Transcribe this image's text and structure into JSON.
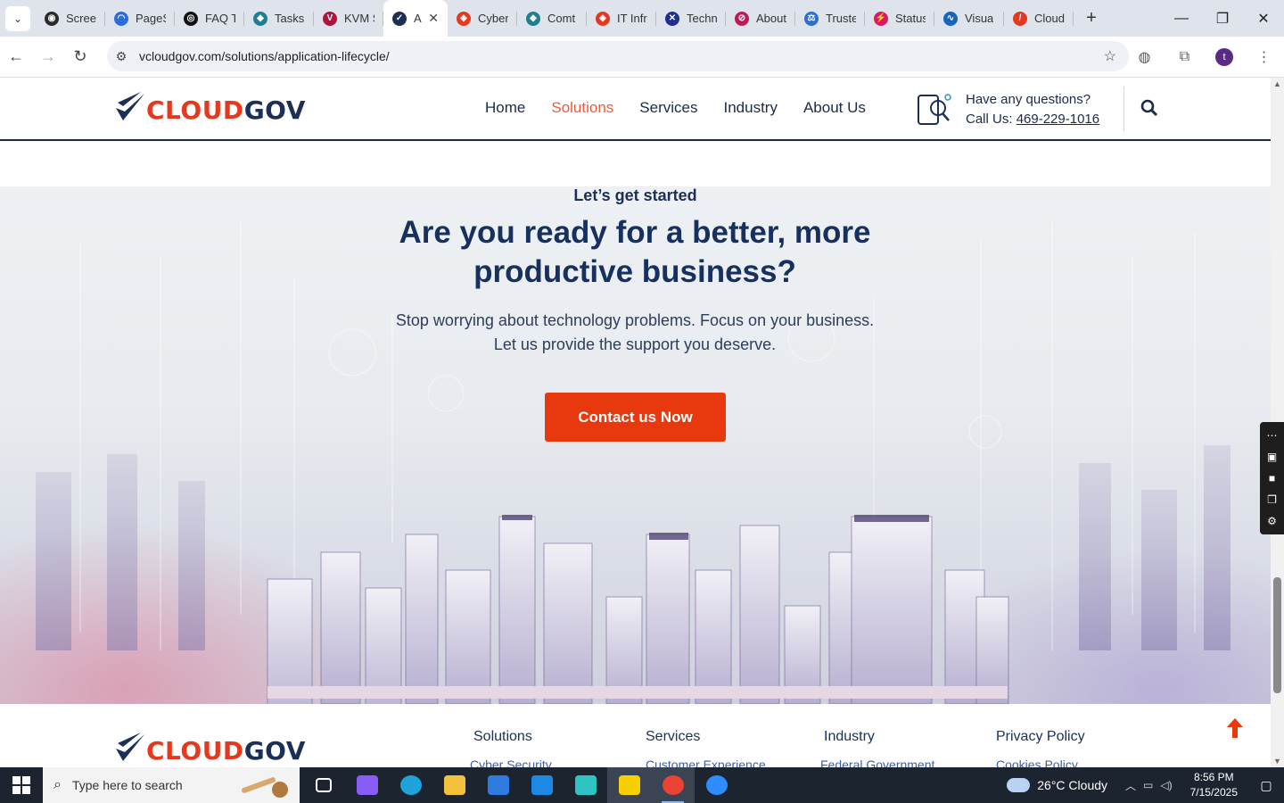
{
  "browser": {
    "tabs": [
      {
        "label": "Scree",
        "color": "#2b2b2b",
        "glyph": "◉"
      },
      {
        "label": "PageS",
        "color": "#2b6fd6",
        "glyph": "◠"
      },
      {
        "label": "FAQ T",
        "color": "#111111",
        "glyph": "◎"
      },
      {
        "label": "Tasks",
        "color": "#1e7f8f",
        "glyph": "◆"
      },
      {
        "label": "KVM S",
        "color": "#b0123a",
        "glyph": "V"
      },
      {
        "label": "A",
        "color": "#1b2f57",
        "glyph": "✓",
        "active": true
      },
      {
        "label": "Cyber",
        "color": "#e5391f",
        "glyph": "◈"
      },
      {
        "label": "Comt",
        "color": "#1e7f8f",
        "glyph": "◆"
      },
      {
        "label": "IT Infr",
        "color": "#e5391f",
        "glyph": "◈"
      },
      {
        "label": "Techn",
        "color": "#1f2f8a",
        "glyph": "✕"
      },
      {
        "label": "About",
        "color": "#c2185b",
        "glyph": "⊘"
      },
      {
        "label": "Truste",
        "color": "#2b6fd6",
        "glyph": "⚖"
      },
      {
        "label": "Status",
        "color": "#d81b60",
        "glyph": "⚡"
      },
      {
        "label": "Visua",
        "color": "#1565c0",
        "glyph": "∿"
      },
      {
        "label": "Cloud",
        "color": "#e5391f",
        "glyph": "/"
      }
    ],
    "url": "vcloudgov.com/solutions/application-lifecycle/",
    "profile_initial": "t"
  },
  "site": {
    "logo": {
      "part1": "CLOUD",
      "part2": "GOV"
    },
    "nav": [
      {
        "label": "Home",
        "active": false
      },
      {
        "label": "Solutions",
        "active": true
      },
      {
        "label": "Services",
        "active": false
      },
      {
        "label": "Industry",
        "active": false
      },
      {
        "label": "About Us",
        "active": false
      }
    ],
    "contact": {
      "question": "Have any questions?",
      "call_prefix": "Call Us: ",
      "phone": "469-229-1016"
    }
  },
  "hero": {
    "kicker": "Let’s get started",
    "title": "Are you ready for a better, more productive business?",
    "subtitle_line1": "Stop worrying about technology problems. Focus on your business.",
    "subtitle_line2": "Let us provide the support you deserve.",
    "cta": "Contact us Now"
  },
  "footer": {
    "columns": [
      {
        "heading": "Solutions",
        "link": "Cyber Security"
      },
      {
        "heading": "Services",
        "link": "Customer Experience"
      },
      {
        "heading": "Industry",
        "link": "Federal Government"
      },
      {
        "heading": "Privacy Policy",
        "link": "Cookies Policy"
      }
    ]
  },
  "taskbar": {
    "search_placeholder": "Type here to search",
    "apps": [
      {
        "name": "task-view",
        "color": "#ffffff"
      },
      {
        "name": "copilot",
        "color": "#8a5cf6"
      },
      {
        "name": "edge",
        "color": "#1fa3d8"
      },
      {
        "name": "file-explorer",
        "color": "#f2c23a"
      },
      {
        "name": "store",
        "color": "#2f7be0"
      },
      {
        "name": "mail",
        "color": "#1e88e5"
      },
      {
        "name": "app-teal",
        "color": "#2ec4c4"
      },
      {
        "name": "sticky-notes",
        "color": "#f8d000"
      },
      {
        "name": "chrome",
        "color": "#ea4335"
      },
      {
        "name": "zoom",
        "color": "#2d8cff"
      }
    ],
    "weather": "26°C  Cloudy",
    "time": "8:56 PM",
    "date": "7/15/2025"
  }
}
